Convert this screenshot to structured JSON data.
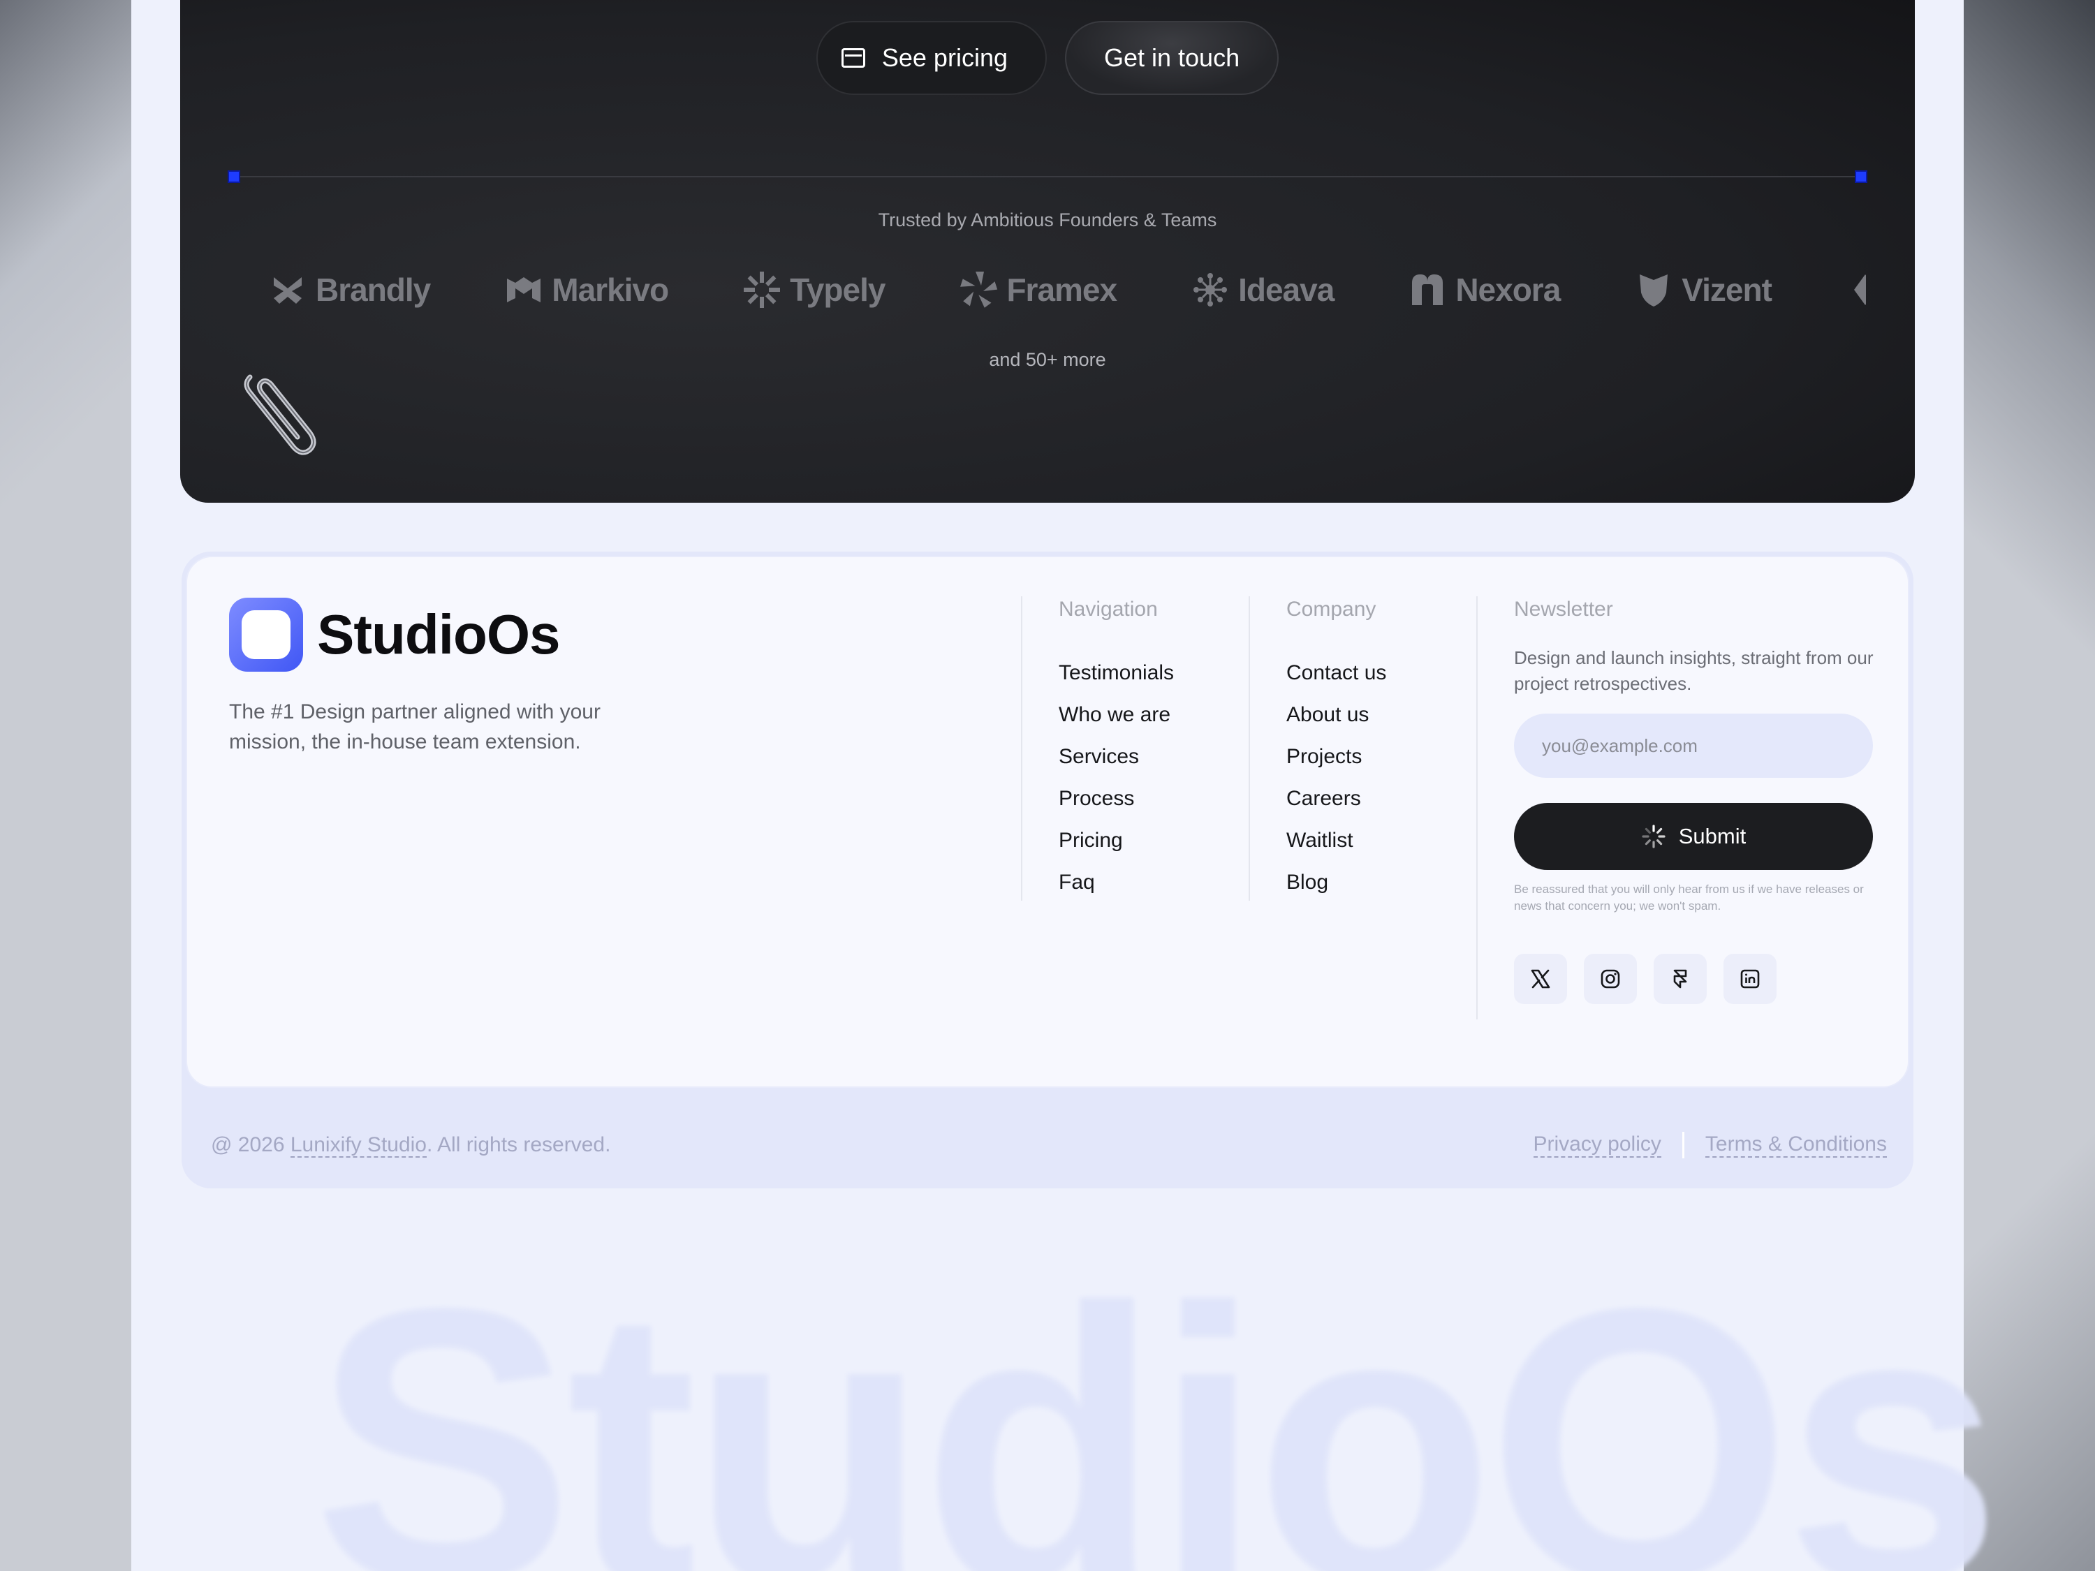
{
  "hero": {
    "see_pricing_label": "See pricing",
    "get_in_touch_label": "Get in touch",
    "trusted_text": "Trusted by Ambitious Founders & Teams",
    "more_text": "and 50+ more",
    "logos": [
      "Brandly",
      "Markivo",
      "Typely",
      "Framex",
      "Ideava",
      "Nexora",
      "Vizent"
    ]
  },
  "footer": {
    "brand_name": "StudioOs",
    "tagline": "The #1 Design partner aligned with your mission, the in-house team extension.",
    "navigation": {
      "title": "Navigation",
      "links": [
        "Testimonials",
        "Who we are",
        "Services",
        "Process",
        "Pricing",
        "Faq"
      ]
    },
    "company": {
      "title": "Company",
      "links": [
        "Contact us",
        "About us",
        "Projects",
        "Careers",
        "Waitlist",
        "Blog"
      ]
    },
    "newsletter": {
      "title": "Newsletter",
      "description": "Design and launch insights, straight from our project retrospectives.",
      "placeholder": "you@example.com",
      "submit_label": "Submit",
      "fine_print": "Be reassured that you will only hear from us if we have releases or news that concern you; we won't spam."
    },
    "socials": [
      "x-icon",
      "instagram-icon",
      "framer-icon",
      "linkedin-icon"
    ],
    "copyright_prefix": "@ 2026",
    "copyright_studio": "Lunixify Studio",
    "copyright_suffix": ". All rights reserved.",
    "privacy_label": "Privacy policy",
    "terms_label": "Terms & Conditions"
  },
  "watermark": "StudioOs",
  "colors": {
    "accent": "#4057f5",
    "handle": "#1e3cff",
    "dark_card": "#1f2024",
    "page_bg": "#eef1fc"
  }
}
